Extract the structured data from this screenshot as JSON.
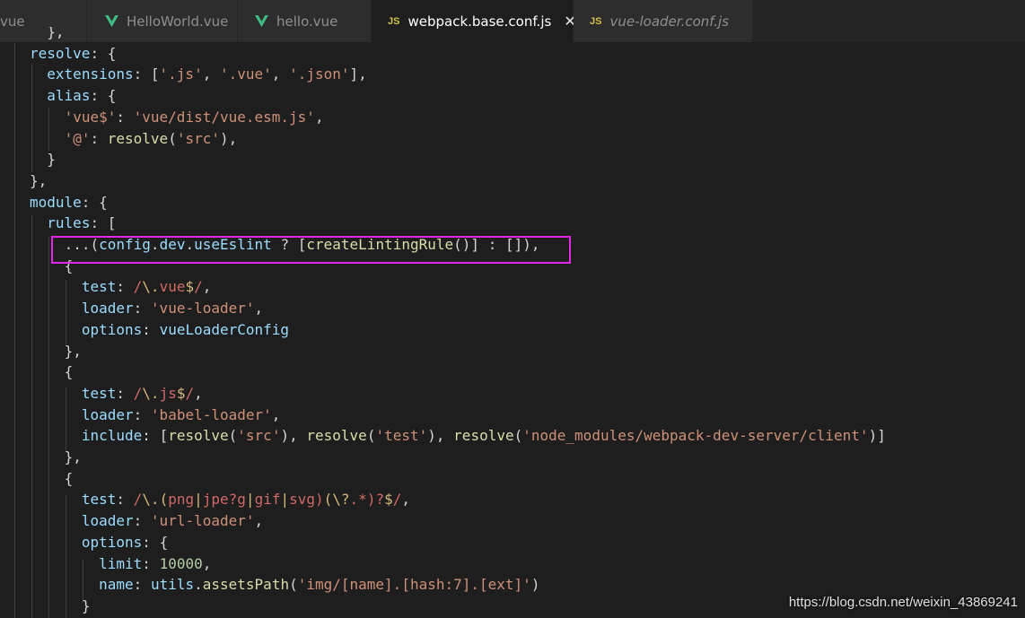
{
  "tabs": [
    {
      "label": "vue",
      "icon": "none",
      "active": false,
      "italic": false
    },
    {
      "label": "HelloWorld.vue",
      "icon": "vue-icon",
      "active": false,
      "italic": false
    },
    {
      "label": "hello.vue",
      "icon": "vue-icon",
      "active": false,
      "italic": false
    },
    {
      "label": "webpack.base.conf.js",
      "icon": "js-icon",
      "active": true,
      "italic": false
    },
    {
      "label": "vue-loader.conf.js",
      "icon": "js-icon",
      "active": false,
      "italic": true
    }
  ],
  "tab_icon_text": "JS",
  "close_glyph": "✕",
  "code_lines": [
    "  },",
    "resolve: {",
    "  extensions: ['.js', '.vue', '.json'],",
    "  alias: {",
    "    'vue$': 'vue/dist/vue.esm.js',",
    "    '@': resolve('src'),",
    "  }",
    "},",
    "module: {",
    "  rules: [",
    "    ...(config.dev.useEslint ? [createLintingRule()] : []),",
    "    {",
    "      test: /\\.vue$/,",
    "      loader: 'vue-loader',",
    "      options: vueLoaderConfig",
    "    },",
    "    {",
    "      test: /\\.js$/,",
    "      loader: 'babel-loader',",
    "      include: [resolve('src'), resolve('test'), resolve('node_modules/webpack-dev-server/client')]",
    "    },",
    "    {",
    "      test: /\\.(png|jpe?g|gif|svg)(\\?.*)?$/,",
    "      loader: 'url-loader',",
    "      options: {",
    "        limit: 10000,",
    "        name: utils.assetsPath('img/[name].[hash:7].[ext]')",
    "      }"
  ],
  "watermark": "https://blog.csdn.net/weixin_43869241",
  "colors": {
    "background": "#1e1e1e",
    "property": "#9cdcfe",
    "string": "#ce9178",
    "function": "#dcdcaa",
    "number": "#b5cea8",
    "regex": "#d16969",
    "highlight_box": "#e626e6",
    "vue_green": "#41b883",
    "js_yellow": "#d2c047"
  }
}
